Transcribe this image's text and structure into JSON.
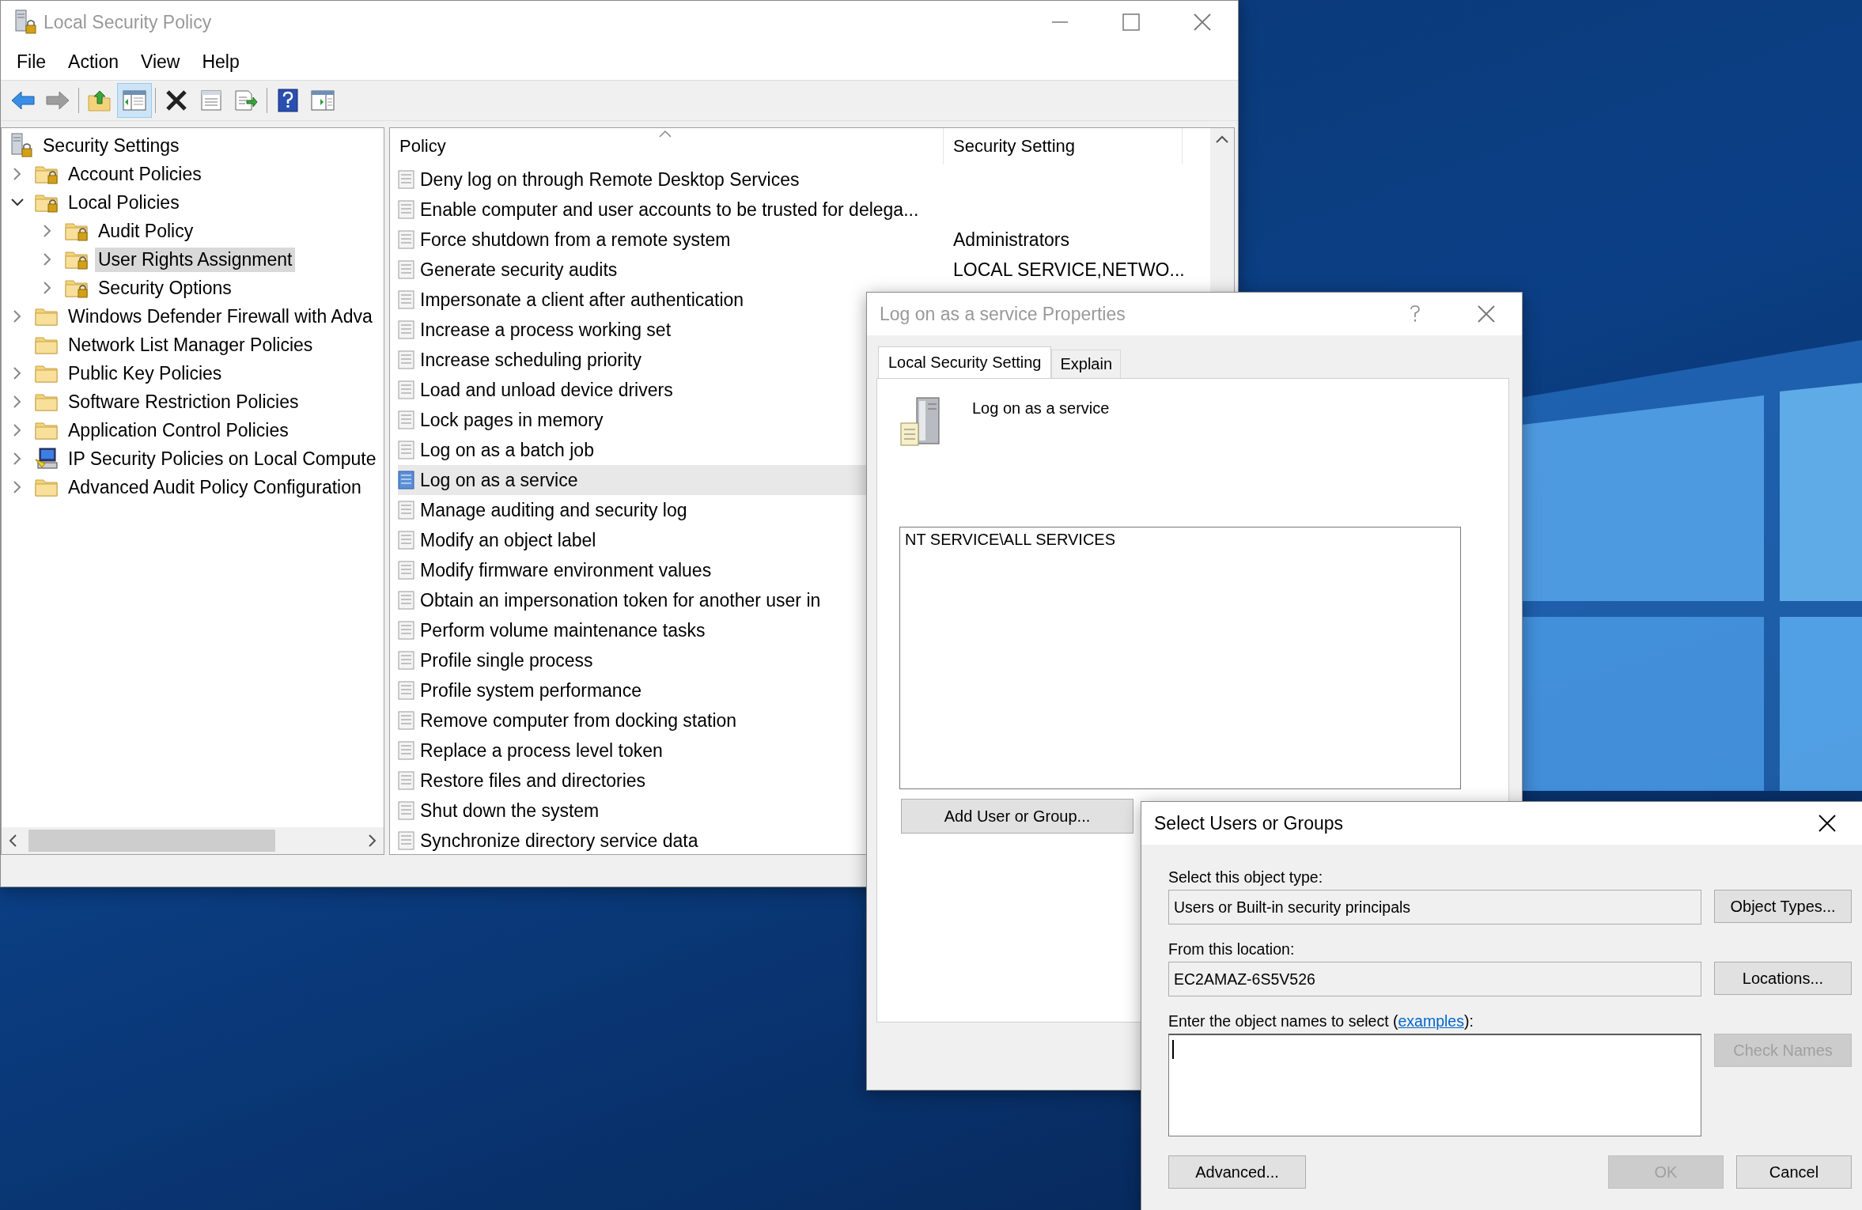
{
  "main_window": {
    "title": "Local Security Policy",
    "active": false,
    "menu": [
      "File",
      "Action",
      "View",
      "Help"
    ],
    "toolbar": [
      {
        "kind": "back",
        "disabled": false,
        "pressed": false
      },
      {
        "kind": "forward",
        "disabled": true,
        "pressed": false
      },
      {
        "kind": "separator"
      },
      {
        "kind": "up-folder",
        "disabled": false,
        "pressed": false
      },
      {
        "kind": "console-tree",
        "disabled": false,
        "pressed": true
      },
      {
        "kind": "separator"
      },
      {
        "kind": "delete",
        "disabled": false,
        "pressed": false
      },
      {
        "kind": "properties",
        "disabled": false,
        "pressed": false
      },
      {
        "kind": "export",
        "disabled": false,
        "pressed": false
      },
      {
        "kind": "separator"
      },
      {
        "kind": "help",
        "disabled": false,
        "pressed": false
      },
      {
        "kind": "action-pane",
        "disabled": false,
        "pressed": false
      }
    ],
    "tree": {
      "label": "Security Settings",
      "kind": "root",
      "selected": false,
      "children": [
        {
          "label": "Account Policies",
          "kind": "lock-folder",
          "expanded": false,
          "selected": false
        },
        {
          "label": "Local Policies",
          "kind": "lock-folder",
          "expanded": true,
          "selected": false,
          "children": [
            {
              "label": "Audit Policy",
              "kind": "lock-folder",
              "expanded": false,
              "selected": false
            },
            {
              "label": "User Rights Assignment",
              "kind": "lock-folder",
              "expanded": false,
              "selected": true
            },
            {
              "label": "Security Options",
              "kind": "lock-folder",
              "expanded": false,
              "selected": false
            }
          ]
        },
        {
          "label": "Windows Defender Firewall with Adva",
          "kind": "folder",
          "expanded": false,
          "selected": false
        },
        {
          "label": "Network List Manager Policies",
          "kind": "folder",
          "selected": false
        },
        {
          "label": "Public Key Policies",
          "kind": "folder",
          "expanded": false,
          "selected": false
        },
        {
          "label": "Software Restriction Policies",
          "kind": "folder",
          "expanded": false,
          "selected": false
        },
        {
          "label": "Application Control Policies",
          "kind": "folder",
          "expanded": false,
          "selected": false
        },
        {
          "label": "IP Security Policies on Local Compute",
          "kind": "computer",
          "expanded": false,
          "selected": false
        },
        {
          "label": "Advanced Audit Policy Configuration",
          "kind": "folder",
          "expanded": false,
          "selected": false
        }
      ]
    },
    "columns": [
      {
        "label": "Policy",
        "sorted": true
      },
      {
        "label": "Security Setting"
      }
    ],
    "rows": [
      {
        "policy": "Deny log on through Remote Desktop Services",
        "selected": false
      },
      {
        "policy": "Enable computer and user accounts to be trusted for delega...",
        "selected": false
      },
      {
        "policy": "Force shutdown from a remote system",
        "setting": "Administrators",
        "selected": false
      },
      {
        "policy": "Generate security audits",
        "setting": "LOCAL SERVICE,NETWO...",
        "selected": false
      },
      {
        "policy": "Impersonate a client after authentication",
        "selected": false
      },
      {
        "policy": "Increase a process working set",
        "selected": false
      },
      {
        "policy": "Increase scheduling priority",
        "selected": false
      },
      {
        "policy": "Load and unload device drivers",
        "selected": false
      },
      {
        "policy": "Lock pages in memory",
        "selected": false
      },
      {
        "policy": "Log on as a batch job",
        "selected": false
      },
      {
        "policy": "Log on as a service",
        "selected": true
      },
      {
        "policy": "Manage auditing and security log",
        "selected": false
      },
      {
        "policy": "Modify an object label",
        "selected": false
      },
      {
        "policy": "Modify firmware environment values",
        "selected": false
      },
      {
        "policy": "Obtain an impersonation token for another user in",
        "selected": false
      },
      {
        "policy": "Perform volume maintenance tasks",
        "selected": false
      },
      {
        "policy": "Profile single process",
        "selected": false
      },
      {
        "policy": "Profile system performance",
        "selected": false
      },
      {
        "policy": "Remove computer from docking station",
        "selected": false
      },
      {
        "policy": "Replace a process level token",
        "selected": false
      },
      {
        "policy": "Restore files and directories",
        "selected": false
      },
      {
        "policy": "Shut down the system",
        "selected": false
      },
      {
        "policy": "Synchronize directory service data",
        "selected": false
      }
    ]
  },
  "properties_dialog": {
    "title": "Log on as a service Properties",
    "active": false,
    "tabs": [
      {
        "label": "Local Security Setting",
        "selected": true
      },
      {
        "label": "Explain",
        "selected": false
      }
    ],
    "policy_name": "Log on as a service",
    "members": [
      "NT SERVICE\\ALL SERVICES"
    ],
    "add_button": "Add User or Group..."
  },
  "select_dialog": {
    "title": "Select Users or Groups",
    "active": true,
    "object_type_label": "Select this object type:",
    "object_type": "Users or Built-in security principals",
    "location_label": "From this location:",
    "location": "EC2AMAZ-6S5V526",
    "names_label": {
      "before": "Enter the object names to select (",
      "link": "examples",
      "after": "):"
    },
    "side_buttons": [
      {
        "label": "Object Types...",
        "disabled": false
      },
      {
        "label": "Locations...",
        "disabled": false
      },
      {
        "label": "Check Names",
        "disabled": true
      }
    ],
    "bottom_buttons": [
      {
        "label": "Advanced...",
        "disabled": false
      },
      {
        "label": "OK",
        "disabled": true
      },
      {
        "label": "Cancel",
        "disabled": false
      }
    ]
  }
}
